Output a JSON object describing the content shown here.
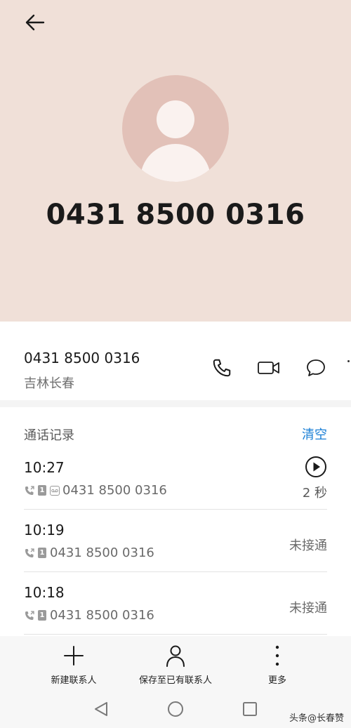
{
  "header": {
    "back_icon": "arrow-left-icon",
    "avatar_icon": "person-avatar-icon",
    "phone_number": "0431 8500 0316",
    "background_color": "#f0e0d8"
  },
  "contact": {
    "number": "0431 8500 0316",
    "location": "吉林长春",
    "actions": {
      "call_icon": "phone-icon",
      "video_icon": "video-call-icon",
      "message_icon": "message-icon"
    }
  },
  "call_log": {
    "title": "通话记录",
    "clear_label": "清空",
    "accent_color": "#1a7fd6",
    "records": [
      {
        "time": "10:27",
        "number": "0431 8500 0316",
        "voicemail": true,
        "duration": "2 秒"
      },
      {
        "time": "10:19",
        "number": "0431 8500 0316",
        "status": "未接通"
      },
      {
        "time": "10:18",
        "number": "0431 8500 0316",
        "status": "未接通"
      }
    ],
    "sim_label": "1"
  },
  "toolbar": {
    "new_contact": "新建联系人",
    "save_existing": "保存至已有联系人",
    "more": "更多"
  },
  "watermark": "头条@长春赞"
}
